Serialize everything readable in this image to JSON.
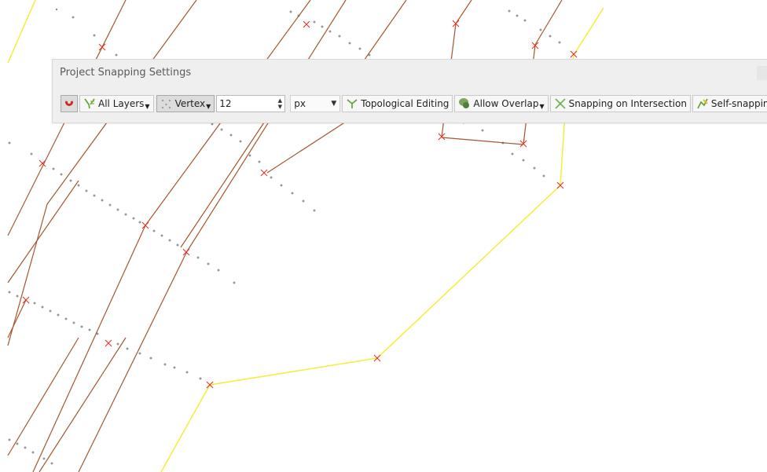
{
  "panel": {
    "title": "Project Snapping Settings"
  },
  "toolbar": {
    "snapping_enabled_icon": "magnet-icon",
    "layers_label": "All Layers",
    "type_label": "Vertex",
    "tolerance_value": "12",
    "units_value": "px",
    "topological_label": "Topological Editing",
    "overlap_label": "Allow Overlap",
    "intersection_label": "Snapping on Intersection",
    "self_snapping_label": "Self-snapping"
  },
  "colors": {
    "brown_lines": "#a0522d",
    "yellow_line": "#f4ee2a",
    "vertex_marker": "#e0332a",
    "dots": "#6a6a6a"
  }
}
